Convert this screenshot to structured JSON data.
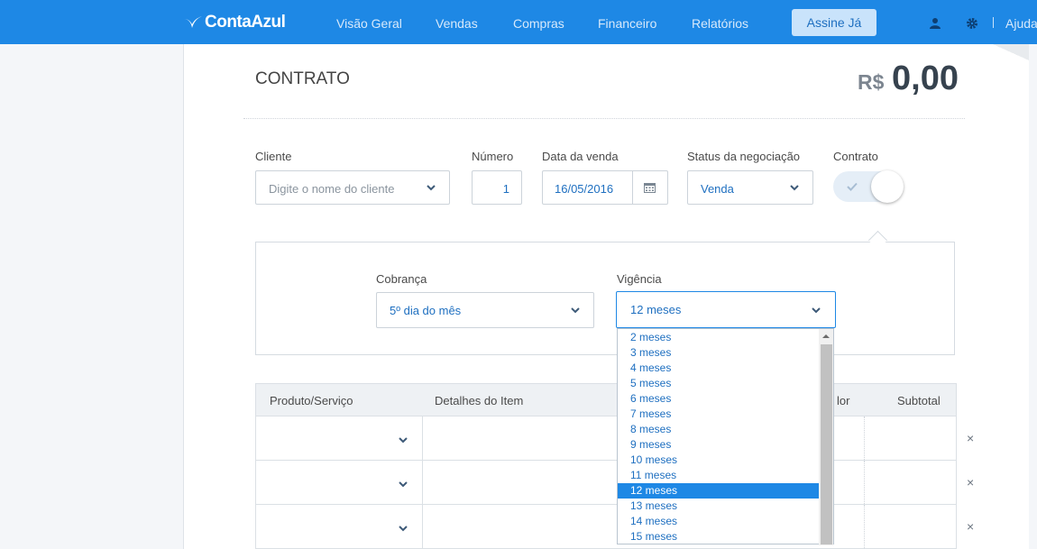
{
  "topbar": {
    "logo": "ContaAzul",
    "nav": [
      "Visão Geral",
      "Vendas",
      "Compras",
      "Financeiro",
      "Relatórios"
    ],
    "cta": "Assine Já",
    "help": "Ajuda",
    "icons": [
      "user-icon",
      "gear-icon"
    ],
    "accent_color": "#1e88e5"
  },
  "header": {
    "title": "CONTRATO",
    "currency": "R$",
    "amount": "0,00"
  },
  "form": {
    "cliente": {
      "label": "Cliente",
      "placeholder": "Digite o nome do cliente"
    },
    "numero": {
      "label": "Número",
      "value": "1"
    },
    "data": {
      "label": "Data da venda",
      "value": "16/05/2016"
    },
    "status": {
      "label": "Status da negociação",
      "value": "Venda"
    },
    "contrato": {
      "label": "Contrato",
      "enabled": true
    }
  },
  "contract_panel": {
    "cobranca": {
      "label": "Cobrança",
      "value": "5º dia do mês"
    },
    "vigencia": {
      "label": "Vigência",
      "value": "12 meses"
    }
  },
  "vigencia_options": [
    "2 meses",
    "3 meses",
    "4 meses",
    "5 meses",
    "6 meses",
    "7 meses",
    "8 meses",
    "9 meses",
    "10 meses",
    "11 meses",
    "12 meses",
    "13 meses",
    "14 meses",
    "15 meses"
  ],
  "vigencia_selected": "12 meses",
  "table": {
    "headers": [
      "Produto/Serviço",
      "Detalhes do Item",
      "lor",
      "Subtotal"
    ],
    "remove_glyph": "×"
  }
}
